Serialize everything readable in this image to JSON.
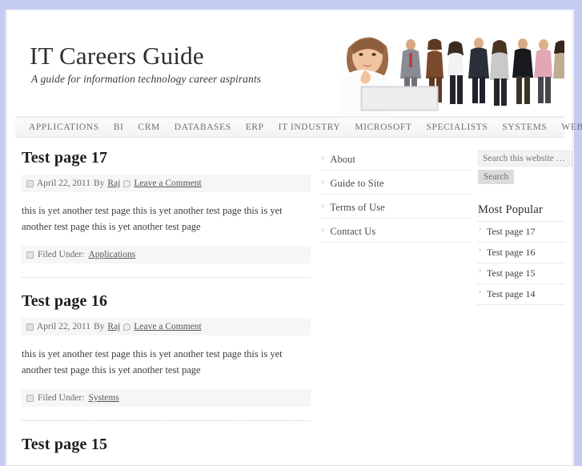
{
  "browser": {
    "top_band_color": "#c5ccf3"
  },
  "header": {
    "site_title": "IT Careers Guide",
    "site_description": "A guide for information technology career aspirants",
    "photo_alt": "business-people-photo"
  },
  "nav": {
    "items": [
      {
        "label": "APPLICATIONS"
      },
      {
        "label": "BI"
      },
      {
        "label": "CRM"
      },
      {
        "label": "DATABASES"
      },
      {
        "label": "ERP"
      },
      {
        "label": "IT INDUSTRY"
      },
      {
        "label": "MICROSOFT"
      },
      {
        "label": "SPECIALISTS"
      },
      {
        "label": "SYSTEMS"
      },
      {
        "label": "WEB"
      }
    ]
  },
  "content": {
    "posts": [
      {
        "title": "Test page 17",
        "date": "April 22, 2011",
        "by_label": "By",
        "author": "Raj",
        "comment_link": "Leave a Comment",
        "body": "this is yet another test page this is yet another test page this is yet another test page this is yet another test page",
        "filed_label": "Filed Under:",
        "category": "Applications"
      },
      {
        "title": "Test page 16",
        "date": "April 22, 2011",
        "by_label": "By",
        "author": "Raj",
        "comment_link": "Leave a Comment",
        "body": "this is yet another test page this is yet another test page this is yet another test page this is yet another test page",
        "filed_label": "Filed Under:",
        "category": "Systems"
      },
      {
        "title": "Test page 15",
        "date": "",
        "by_label": "",
        "author": "",
        "comment_link": "",
        "body": "",
        "filed_label": "",
        "category": ""
      }
    ]
  },
  "midbar": {
    "items": [
      {
        "label": "About"
      },
      {
        "label": "Guide to Site"
      },
      {
        "label": "Terms of Use"
      },
      {
        "label": "Contact Us"
      }
    ]
  },
  "sidebar": {
    "search": {
      "placeholder": "Search this website …",
      "value": "",
      "button_label": "Search"
    },
    "widget": {
      "title": "Most Popular",
      "items": [
        {
          "label": "Test page 17"
        },
        {
          "label": "Test page 16"
        },
        {
          "label": "Test page 15"
        },
        {
          "label": "Test page 14"
        }
      ]
    }
  }
}
